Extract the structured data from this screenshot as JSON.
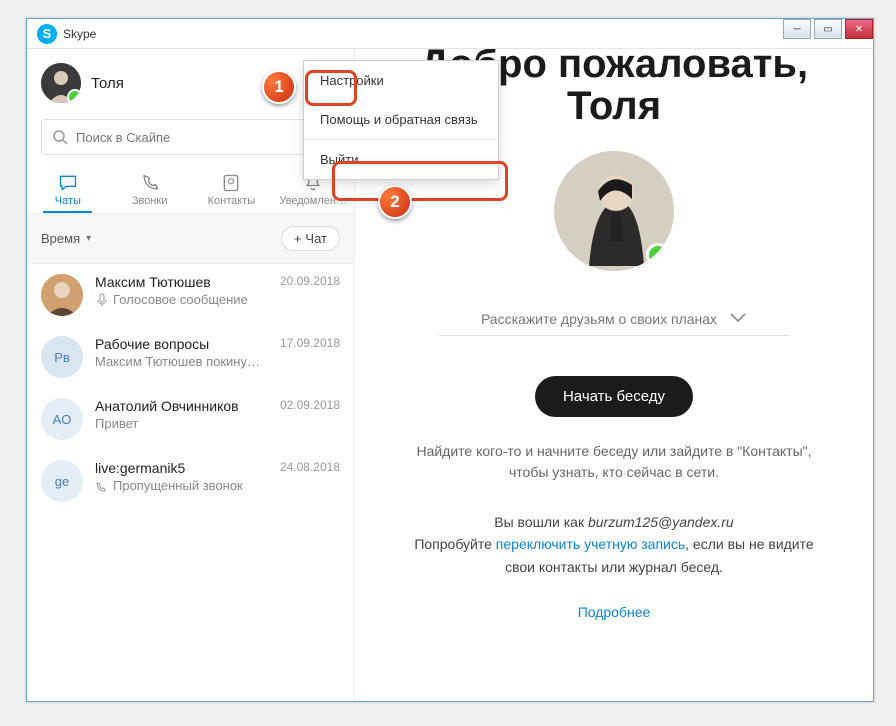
{
  "window": {
    "title": "Skype"
  },
  "profile": {
    "name": "Толя"
  },
  "search": {
    "placeholder": "Поиск в Скайпе"
  },
  "tabs": [
    {
      "label": "Чаты"
    },
    {
      "label": "Звонки"
    },
    {
      "label": "Контакты"
    },
    {
      "label": "Уведомлен…"
    }
  ],
  "section": {
    "label": "Время",
    "newchat": "Чат"
  },
  "chats": [
    {
      "name": "Максим Тютюшев",
      "date": "20.09.2018",
      "sub": "Голосовое сообщение",
      "avatar_bg": "#d0a070",
      "avatar_txt": "",
      "icon": "mic"
    },
    {
      "name": "Рабочие вопросы",
      "date": "17.09.2018",
      "sub": "Максим Тютюшев покину…",
      "avatar_bg": "#d9e6f2",
      "avatar_txt": "Рв",
      "avatar_fg": "#4a7db5",
      "icon": ""
    },
    {
      "name": "Анатолий Овчинников",
      "date": "02.09.2018",
      "sub": "Привет",
      "avatar_bg": "#e5eef6",
      "avatar_txt": "AO",
      "avatar_fg": "#4a7db5",
      "icon": ""
    },
    {
      "name": "live:germanik5",
      "date": "24.08.2018",
      "sub": "Пропущенный звонок",
      "avatar_bg": "#e5eef6",
      "avatar_txt": "ge",
      "avatar_fg": "#4a7db5",
      "icon": "missed"
    }
  ],
  "menu": {
    "settings": "Настройки",
    "help": "Помощь и обратная связь",
    "logout": "Выйти"
  },
  "main": {
    "welcome_l1": "Добро пожаловать,",
    "welcome_l2": "Толя",
    "status_placeholder": "Расскажите друзьям о своих планах",
    "start_button": "Начать беседу",
    "hint": "Найдите кого-то и начните беседу или зайдите в \"Контакты\", чтобы узнать, кто сейчас в сети.",
    "login_prefix": "Вы вошли как ",
    "login_email": "burzum125@yandex.ru",
    "login_try": "Попробуйте ",
    "login_switch": "переключить учетную запись",
    "login_suffix": ", если вы не видите свои контакты или журнал бесед.",
    "more": "Подробнее"
  },
  "callouts": {
    "one": "1",
    "two": "2"
  }
}
